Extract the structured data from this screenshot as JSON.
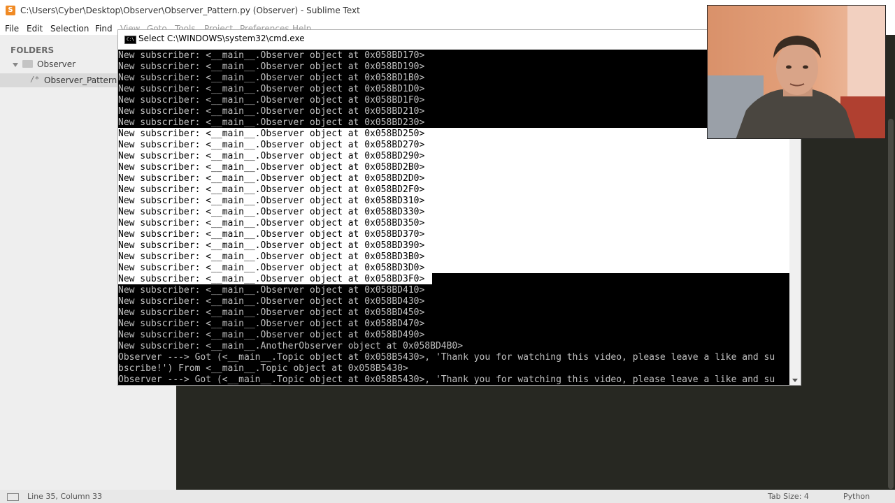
{
  "sublime": {
    "title": "C:\\Users\\Cyber\\Desktop\\Observer\\Observer_Pattern.py (Observer) - Sublime Text",
    "app_icon_glyph": "S",
    "menu": [
      {
        "label": "File"
      },
      {
        "label": "Edit"
      },
      {
        "label": "Selection"
      },
      {
        "label": "Find"
      },
      {
        "label": "View"
      },
      {
        "label": "Goto"
      },
      {
        "label": "Tools"
      },
      {
        "label": "Project"
      },
      {
        "label": "Preferences"
      },
      {
        "label": "Help"
      }
    ],
    "sidebar": {
      "header": "FOLDERS",
      "folder": "Observer",
      "file_icon": "/*",
      "file": "Observer_Pattern.py"
    },
    "status": {
      "position": "Line 35, Column 33",
      "tab_size": "Tab Size: 4",
      "syntax": "Python"
    }
  },
  "cmd": {
    "title": "Select C:\\WINDOWS\\system32\\cmd.exe",
    "icon_glyph": "C:\\",
    "lines": [
      "New subscriber: <__main__.Observer object at 0x058BD170>",
      "New subscriber: <__main__.Observer object at 0x058BD190>",
      "New subscriber: <__main__.Observer object at 0x058BD1B0>",
      "New subscriber: <__main__.Observer object at 0x058BD1D0>",
      "New subscriber: <__main__.Observer object at 0x058BD1F0>",
      "New subscriber: <__main__.Observer object at 0x058BD210>",
      "New subscriber: <__main__.Observer object at 0x058BD230>",
      "New subscriber: <__main__.Observer object at 0x058BD250>",
      "New subscriber: <__main__.Observer object at 0x058BD270>",
      "New subscriber: <__main__.Observer object at 0x058BD290>",
      "New subscriber: <__main__.Observer object at 0x058BD2B0>",
      "New subscriber: <__main__.Observer object at 0x058BD2D0>",
      "New subscriber: <__main__.Observer object at 0x058BD2F0>",
      "New subscriber: <__main__.Observer object at 0x058BD310>",
      "New subscriber: <__main__.Observer object at 0x058BD330>",
      "New subscriber: <__main__.Observer object at 0x058BD350>",
      "New subscriber: <__main__.Observer object at 0x058BD370>",
      "New subscriber: <__main__.Observer object at 0x058BD390>",
      "New subscriber: <__main__.Observer object at 0x058BD3B0>",
      "New subscriber: <__main__.Observer object at 0x058BD3D0>",
      "New subscriber: <__main__.Observer object at 0x058BD3F0>",
      "New subscriber: <__main__.Observer object at 0x058BD410>",
      "New subscriber: <__main__.Observer object at 0x058BD430>",
      "New subscriber: <__main__.Observer object at 0x058BD450>",
      "New subscriber: <__main__.Observer object at 0x058BD470>",
      "New subscriber: <__main__.Observer object at 0x058BD490>",
      "New subscriber: <__main__.AnotherObserver object at 0x058BD4B0>",
      "Observer ---> Got (<__main__.Topic object at 0x058B5430>, 'Thank you for watching this video, please leave a like and su",
      "bscribe!') From <__main__.Topic object at 0x058B5430>",
      "Observer ---> Got (<__main__.Topic object at 0x058B5430>, 'Thank you for watching this video, please leave a like and su"
    ],
    "selected_line_indices": [
      7,
      8,
      9,
      10,
      11,
      12,
      13,
      14,
      15,
      16,
      17,
      18,
      19,
      20
    ]
  },
  "webcam": {
    "icon": "webcam-video-icon"
  },
  "colors": {
    "editor_bg": "#272822",
    "console_bg": "#000000",
    "console_fg": "#c0c0c0",
    "selection_bg": "#ffffff",
    "sidebar_bg": "#eeeeee",
    "sublime_accent": "#f08a24"
  }
}
